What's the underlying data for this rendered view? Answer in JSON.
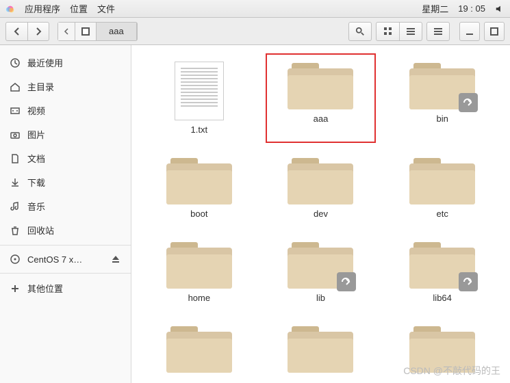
{
  "topbar": {
    "menu": [
      "应用程序",
      "位置",
      "文件"
    ],
    "day": "星期二",
    "time": "19 : 05"
  },
  "toolbar": {
    "breadcrumb": "aaa"
  },
  "sidebar": {
    "items": [
      {
        "icon": "clock",
        "label": "最近使用"
      },
      {
        "icon": "home",
        "label": "主目录"
      },
      {
        "icon": "video",
        "label": "视频"
      },
      {
        "icon": "camera",
        "label": "图片"
      },
      {
        "icon": "doc",
        "label": "文档"
      },
      {
        "icon": "download",
        "label": "下载"
      },
      {
        "icon": "music",
        "label": "音乐"
      },
      {
        "icon": "trash",
        "label": "回收站"
      }
    ],
    "disc": {
      "label": "CentOS 7 x…"
    },
    "other": {
      "label": "其他位置"
    }
  },
  "files": [
    {
      "name": "1.txt",
      "type": "file"
    },
    {
      "name": "aaa",
      "type": "folder",
      "hl": true
    },
    {
      "name": "bin",
      "type": "folder",
      "link": true
    },
    {
      "name": "boot",
      "type": "folder"
    },
    {
      "name": "dev",
      "type": "folder"
    },
    {
      "name": "etc",
      "type": "folder"
    },
    {
      "name": "home",
      "type": "folder"
    },
    {
      "name": "lib",
      "type": "folder",
      "link": true
    },
    {
      "name": "lib64",
      "type": "folder",
      "link": true
    },
    {
      "name": "",
      "type": "folder"
    },
    {
      "name": "",
      "type": "folder"
    },
    {
      "name": "",
      "type": "folder"
    }
  ],
  "watermark": "CSDN @不敲代码的王"
}
